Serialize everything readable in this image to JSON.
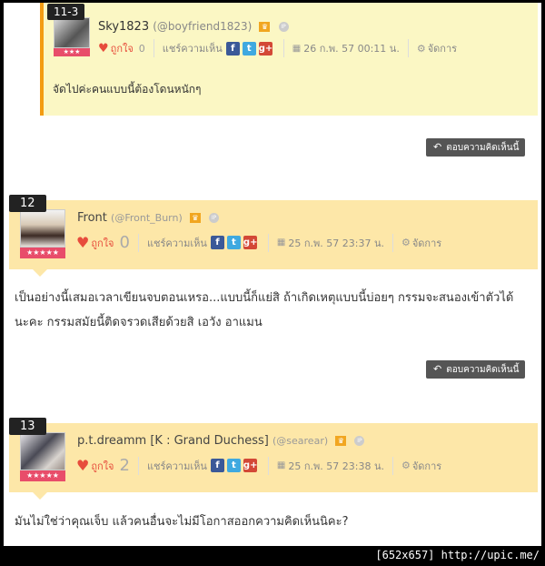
{
  "reply_button_label": "ตอบความคิดเห็นนี้",
  "share_label": "แชร์ความเห็น",
  "manage_label": "จัดการ",
  "like_label": "ถูกใจ",
  "ip_badge": "IP",
  "social": {
    "facebook": "f",
    "twitter": "t",
    "googleplus": "g+"
  },
  "reply": {
    "number": "11-3",
    "username": "Sky1823",
    "handle": "(@boyfriend1823)",
    "likes": "0",
    "date": "26 ก.พ. 57 00:11 น.",
    "text": "จัดไปค่ะคนแบบนี้ต้องโดนหนักๆ"
  },
  "comments": [
    {
      "number": "12",
      "username": "Front",
      "handle": "(@Front_Burn)",
      "likes": "0",
      "date": "25 ก.พ. 57 23:37 น.",
      "text": "เป็นอย่างนี้เสมอเวลาเขียนจบตอนเหรอ...แบบนี้ก็แย่สิ ถ้าเกิดเหตุแบบนี้บ่อยๆ กรรมจะสนองเข้าตัวได้นะคะ กรรมสมัยนี้ติดจรวดเสียด้วยสิ เอวัง อาแมน"
    },
    {
      "number": "13",
      "username": "p.t.dreamm [K : Grand Duchess]",
      "handle": "(@searear)",
      "likes": "2",
      "date": "25 ก.พ. 57 23:38 น.",
      "text": "มันไม่ใช่ว่าคุณเจ็บ แล้วคนอื่นจะไม่มีโอกาสออกความคิดเห็นนิคะ?"
    }
  ],
  "footer": "[652x657] http://upic.me/",
  "colors": {
    "reply_bg": "#fbf7c4",
    "reply_border": "#f39c12",
    "comment_header_bg": "#fde7a8",
    "like": "#e74c3c",
    "star_badge": "#e84d6a"
  }
}
